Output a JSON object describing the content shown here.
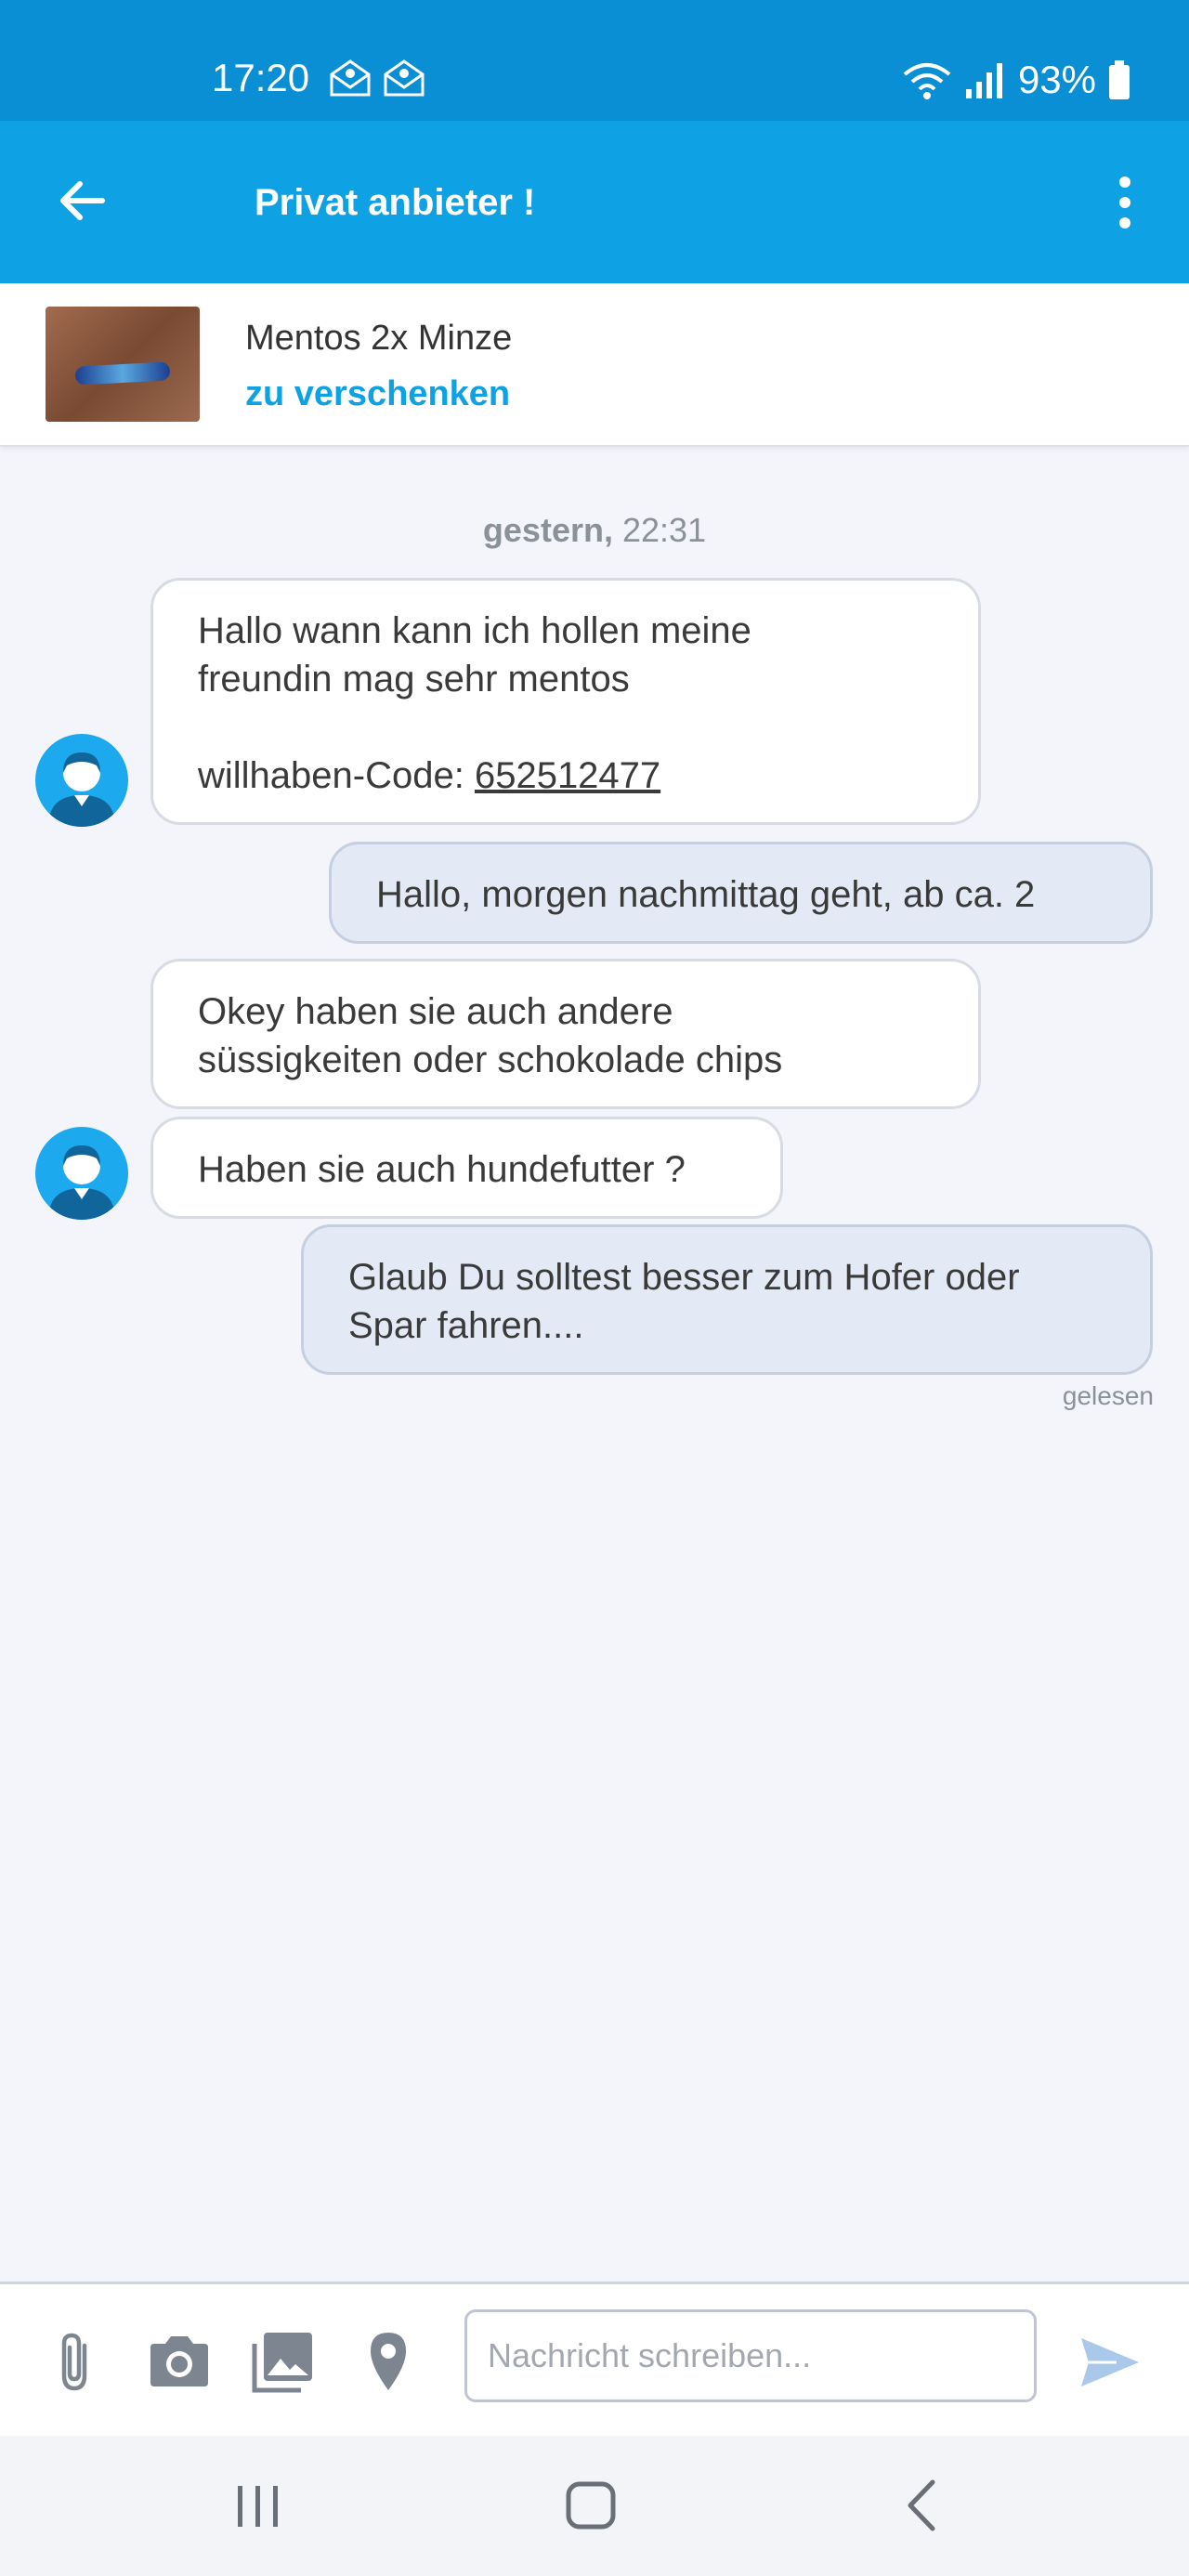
{
  "status_bar": {
    "time": "17:20",
    "battery": "93%"
  },
  "app_bar": {
    "title": "Privat anbieter !"
  },
  "listing": {
    "title": "Mentos 2x Minze",
    "subtitle": "zu verschenken"
  },
  "chat": {
    "date_label": "gestern,",
    "date_time": "22:31",
    "messages": [
      {
        "text": "Hallo wann kann ich hollen meine\nfreundin mag sehr mentos\n\nwillhaben-Code: ",
        "code": "652512477"
      },
      {
        "text": "Hallo, morgen nachmittag geht, ab ca. 2"
      },
      {
        "text": "Okey haben sie auch andere\nsüssigkeiten oder schokolade chips"
      },
      {
        "text": "Haben sie auch hundefutter ?"
      },
      {
        "text": "Glaub Du solltest besser zum Hofer oder\nSpar fahren...."
      }
    ],
    "read_status": "gelesen"
  },
  "composer": {
    "placeholder": "Nachricht schreiben..."
  },
  "colors": {
    "status_bar": "#0a8fd4",
    "app_bar": "#0ea1e4",
    "accent": "#0ea1e4",
    "outgoing_bubble": "#e4e9f6"
  }
}
